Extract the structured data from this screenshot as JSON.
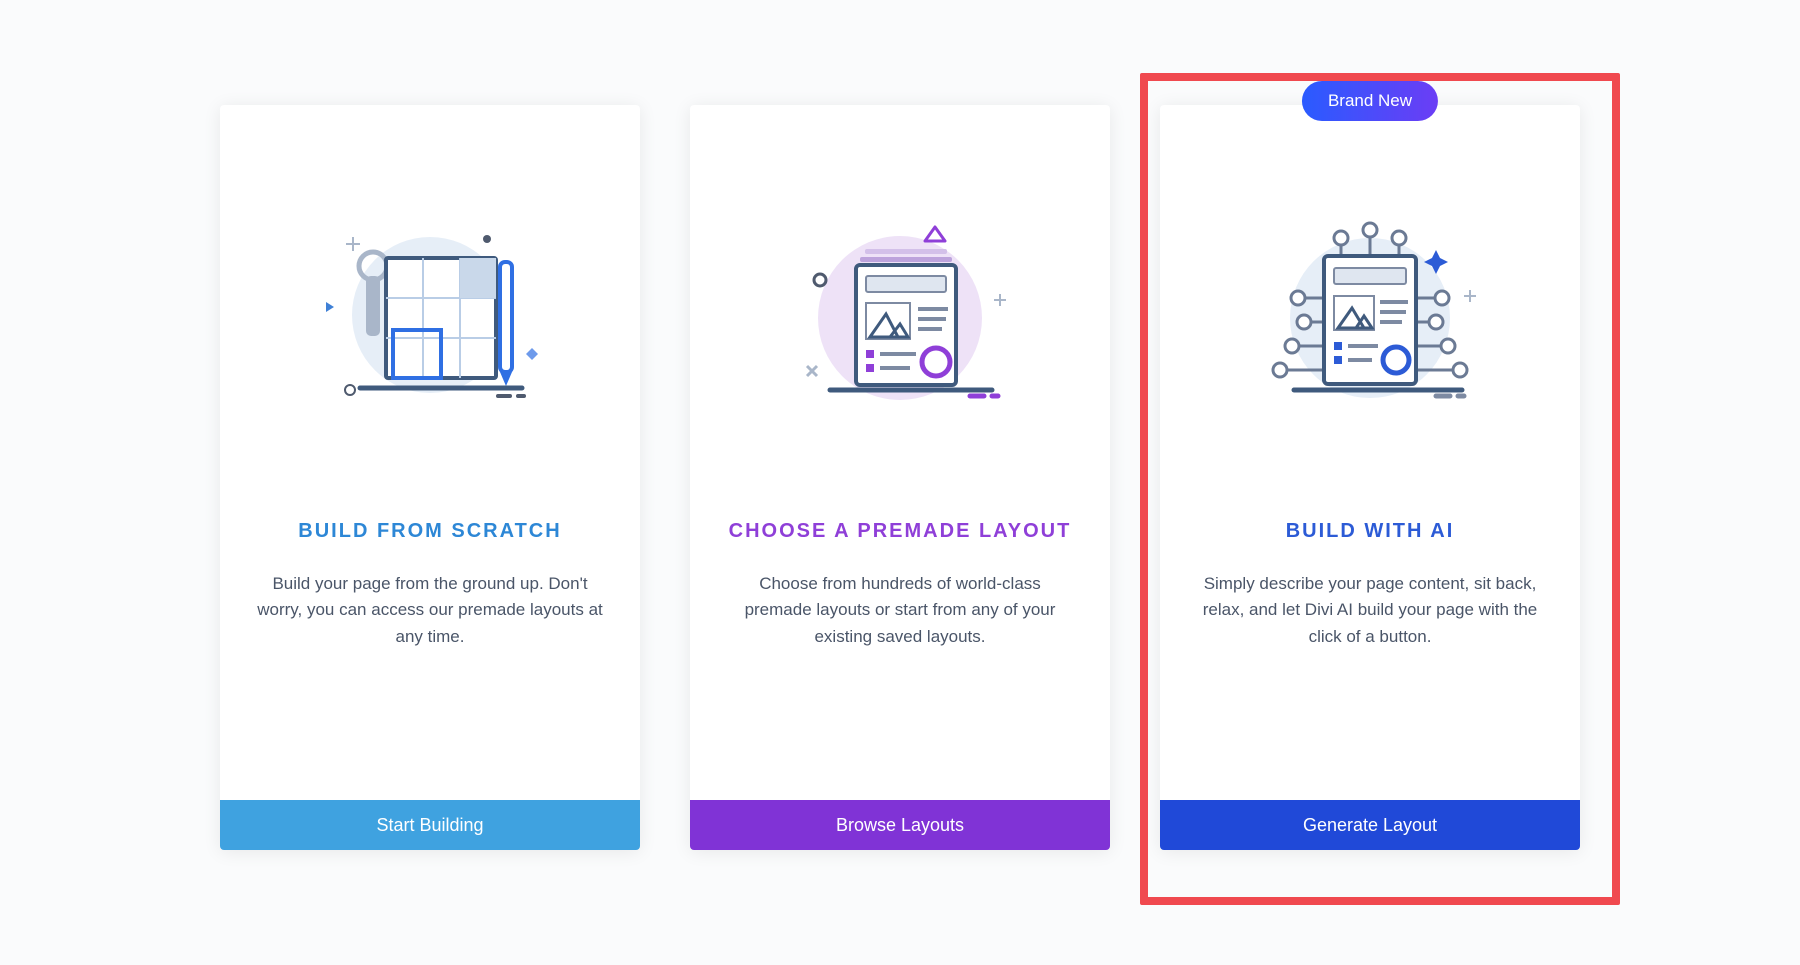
{
  "cards": [
    {
      "title": "BUILD FROM SCRATCH",
      "description": "Build your page from the ground up. Don't worry, you can access our premade layouts at any time.",
      "button": "Start Building"
    },
    {
      "title": "CHOOSE A PREMADE LAYOUT",
      "description": "Choose from hundreds of world-class premade layouts or start from any of your existing saved layouts.",
      "button": "Browse Layouts"
    },
    {
      "title": "BUILD WITH AI",
      "description": "Simply describe your page content, sit back, relax, and let Divi AI build your page with the click of a button.",
      "button": "Generate Layout",
      "badge": "Brand New"
    }
  ]
}
